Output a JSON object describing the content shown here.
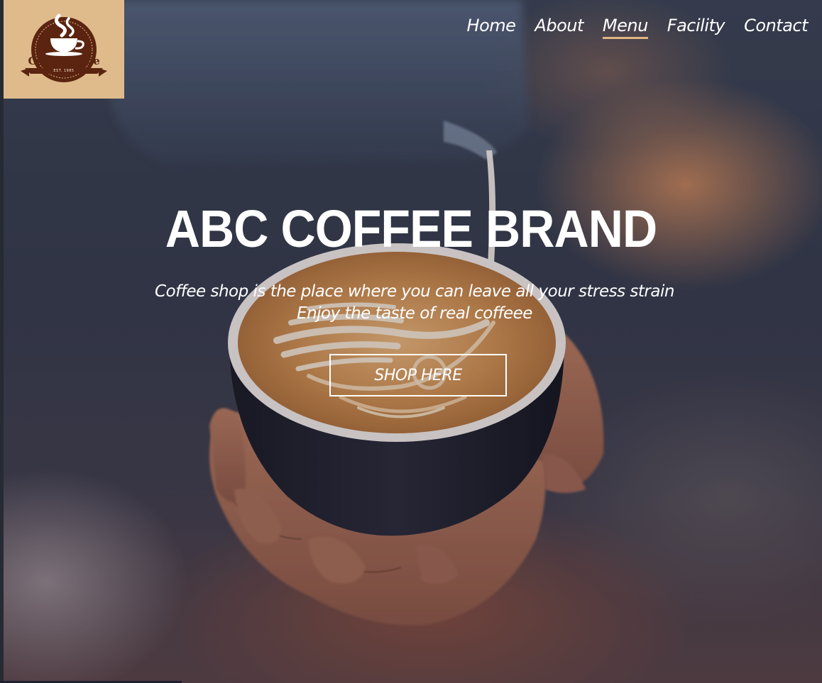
{
  "logo": {
    "name": "Coffee Place",
    "tagline": "EST. 1985",
    "background": "#dfbb8c",
    "color": "#5a2410"
  },
  "nav": {
    "items": [
      {
        "label": "Home",
        "active": false
      },
      {
        "label": "About",
        "active": false
      },
      {
        "label": "Menu",
        "active": true
      },
      {
        "label": "Facility",
        "active": false
      },
      {
        "label": "Contact",
        "active": false
      }
    ],
    "active_underline_color": "#dfb783"
  },
  "hero": {
    "title": "ABC COFFEE BRAND",
    "subtitle_line1": "Coffee shop is the place where you can leave all your stress strain",
    "subtitle_line2": "Enjoy the taste of real coffeee",
    "button_label": "SHOP HERE",
    "background_icon": "latte-art-cup-image"
  }
}
